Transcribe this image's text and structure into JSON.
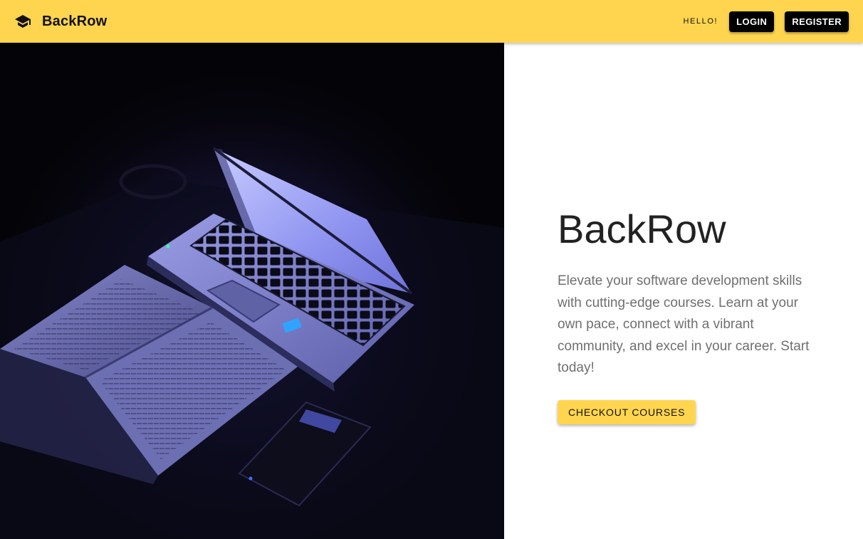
{
  "header": {
    "brand_name": "BackRow",
    "brand_icon": "graduation-cap-icon",
    "greeting": "HELLO!",
    "login_label": "LOGIN",
    "register_label": "REGISTER"
  },
  "hero": {
    "title": "BackRow",
    "description": "Elevate your software development skills with cutting-edge courses. Learn at your own pace, connect with a vibrant community, and excel in your career. Start today!",
    "cta_label": "CHECKOUT COURSES"
  },
  "colors": {
    "accent": "#ffd54f",
    "button_dark": "#000000",
    "title_text": "#222222",
    "body_text": "#6f6f6f"
  }
}
